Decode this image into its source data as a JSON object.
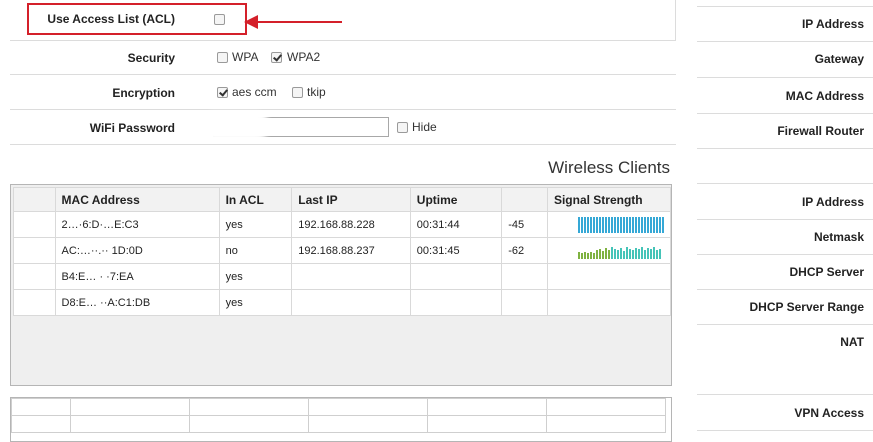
{
  "form": {
    "acl_label": "Use Access List (ACL)",
    "security_label": "Security",
    "security_options": [
      "WPA",
      "WPA2"
    ],
    "encryption_label": "Encryption",
    "encryption_options": [
      "aes ccm",
      "tkip"
    ],
    "wifi_password_label": "WiFi Password",
    "hide_label": "Hide"
  },
  "clients": {
    "title": "Wireless Clients",
    "columns": [
      "",
      "MAC Address",
      "In ACL",
      "Last IP",
      "Uptime",
      "",
      "Signal Strength"
    ],
    "rows": [
      {
        "mac": "2…·6:D·…E:C3",
        "in_acl": "yes",
        "last_ip": "192.168.88.228",
        "uptime": "00:31:44",
        "signal": "-45"
      },
      {
        "mac": "AC:…··.·· 1D:0D",
        "in_acl": "no",
        "last_ip": "192.168.88.237",
        "uptime": "00:31:45",
        "signal": "-62"
      },
      {
        "mac": "B4:E… · ·7:EA",
        "in_acl": "yes",
        "last_ip": "",
        "uptime": "",
        "signal": ""
      },
      {
        "mac": "D8:E… ··A:C1:DB",
        "in_acl": "yes",
        "last_ip": "",
        "uptime": "",
        "signal": ""
      }
    ]
  },
  "sidebar": {
    "items": [
      "IP Address",
      "Gateway",
      "MAC Address",
      "Firewall Router",
      "IP Address",
      "Netmask",
      "DHCP Server",
      "DHCP Server Range",
      "NAT",
      "VPN Access"
    ]
  },
  "colors": {
    "highlight": "#d4202a",
    "signal_strong": "#35a8d6",
    "signal_weak_green": "#7fb241",
    "signal_weak_teal": "#45c4b8"
  }
}
